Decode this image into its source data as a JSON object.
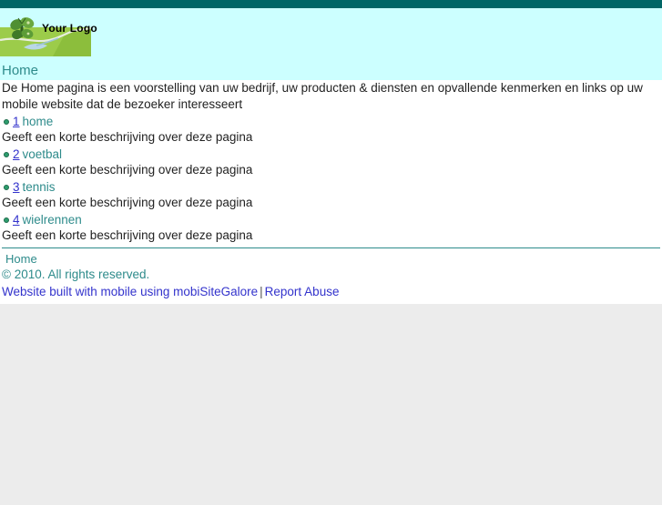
{
  "header": {
    "logo_text": "Your Logo",
    "logo_icon": "butterfly-landscape-logo"
  },
  "page_title": "Home",
  "intro": "De Home pagina is een voorstelling van uw bedrijf, uw producten & diensten en opvallende kenmerken en links op uw mobile website dat de bezoeker interesseert",
  "links": [
    {
      "number": "1",
      "label": "home",
      "description": "Geeft een korte beschrijving over deze pagina"
    },
    {
      "number": "2",
      "label": "voetbal",
      "description": "Geeft een korte beschrijving over deze pagina"
    },
    {
      "number": "3",
      "label": "tennis",
      "description": "Geeft een korte beschrijving over deze pagina"
    },
    {
      "number": "4",
      "label": "wielrennen",
      "description": "Geeft een korte beschrijving over deze pagina"
    }
  ],
  "footer": {
    "home_label": "Home",
    "copyright": "© 2010. All rights reserved.",
    "credit_text": "Website built with mobile using mobiSiteGalore",
    "separator": "|",
    "report_abuse": "Report Abuse"
  },
  "colors": {
    "topbar": "#006666",
    "header_bg": "#ccffff",
    "teal_text": "#2e8b8b",
    "link_blue": "#3333cc",
    "bullet_green": "#2e9d6e",
    "body_bg": "#ffffff",
    "below_bg": "#ececec"
  }
}
